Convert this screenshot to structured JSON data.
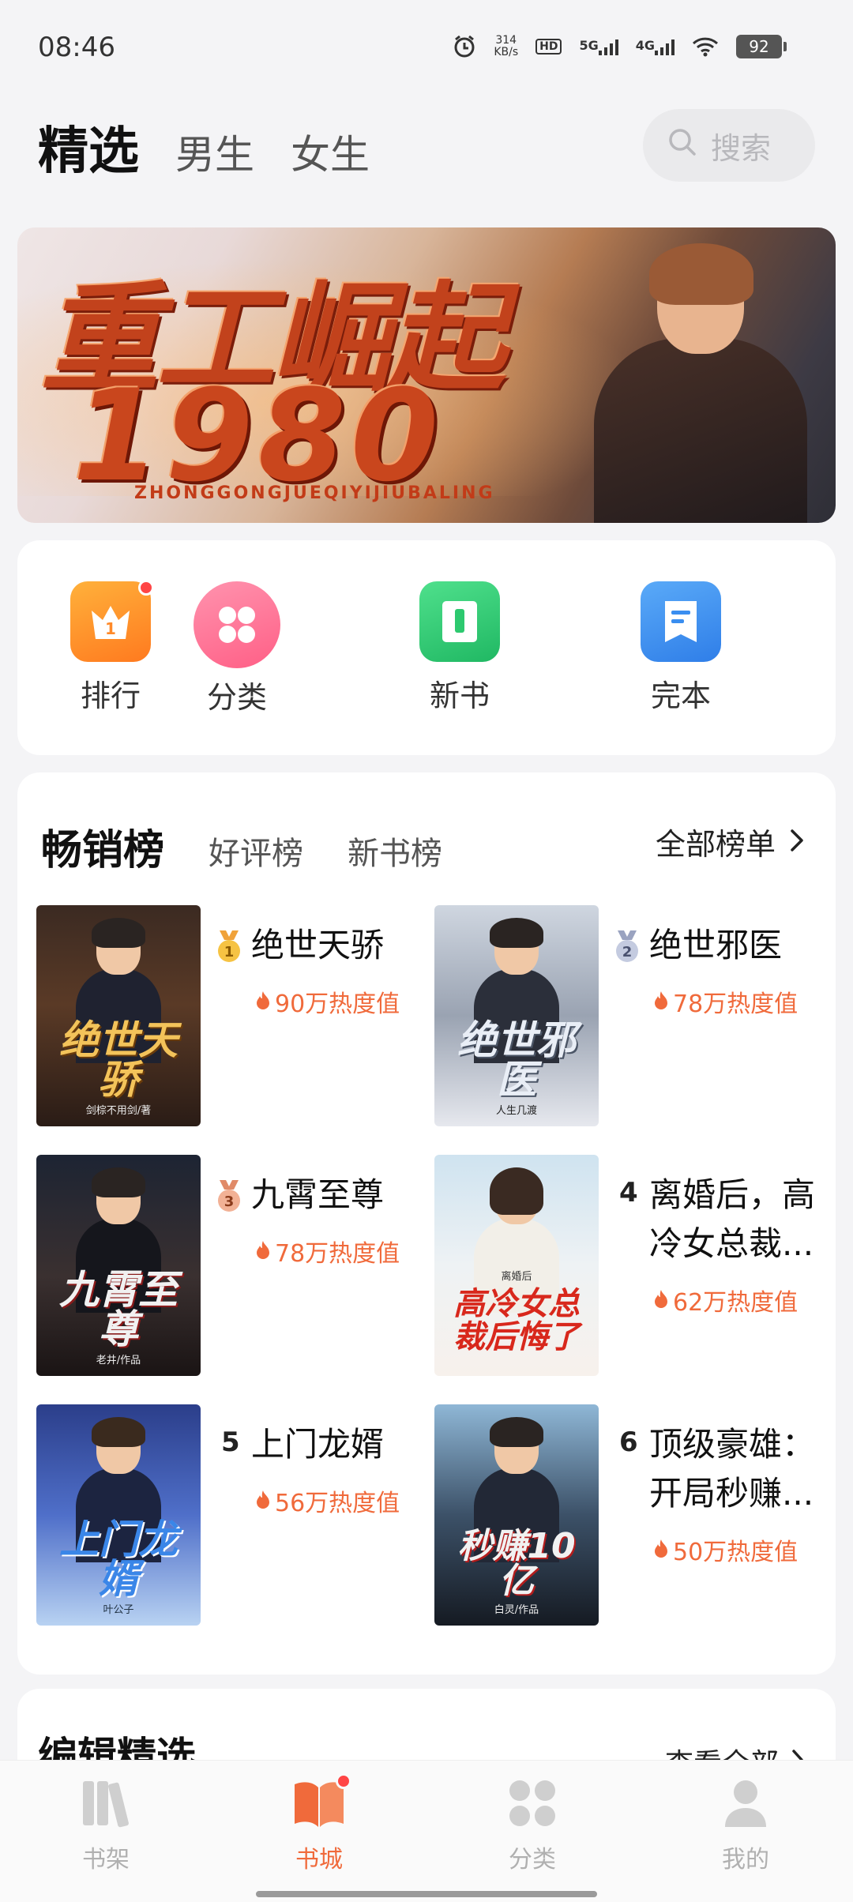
{
  "status_bar": {
    "time": "08:46",
    "net_speed_value": "314",
    "net_speed_unit": "KB/s",
    "hd_label": "HD",
    "signal_1": "5G",
    "signal_2": "4G",
    "battery": "92"
  },
  "top_tabs": [
    "精选",
    "男生",
    "女生"
  ],
  "search": {
    "placeholder": "搜索"
  },
  "banner": {
    "title": "重工崛起",
    "year": "1980",
    "subtitle": "ZHONGGONGJUEQIYIJIUBALING"
  },
  "quick_entries": [
    {
      "label": "排行",
      "icon": "crown-rank-icon",
      "color": "#ff8a2a",
      "has_dot": true
    },
    {
      "label": "分类",
      "icon": "category-grid-icon",
      "color": "#ff5f86",
      "has_dot": false
    },
    {
      "label": "新书",
      "icon": "new-book-icon",
      "color": "#2dc96f",
      "has_dot": false
    },
    {
      "label": "完本",
      "icon": "finished-book-icon",
      "color": "#3a8ef0",
      "has_dot": false
    }
  ],
  "ranking": {
    "tabs": [
      "畅销榜",
      "好评榜",
      "新书榜"
    ],
    "all_lists": "全部榜单",
    "books": [
      {
        "rank": "1",
        "title": "绝世天骄",
        "heat": "90万热度值",
        "cover_title": "绝世天骄",
        "cover_author": "剑棕不用剑/著"
      },
      {
        "rank": "2",
        "title": "绝世邪医",
        "heat": "78万热度值",
        "cover_title": "绝世邪医",
        "cover_author": "人生几渡"
      },
      {
        "rank": "3",
        "title": "九霄至尊",
        "heat": "78万热度值",
        "cover_title": "九霄至尊",
        "cover_author": "老井/作品"
      },
      {
        "rank": "4",
        "title": "离婚后，高冷女总裁...",
        "heat": "62万热度值",
        "cover_title": "高冷女总裁后悔了",
        "cover_author": "离婚后"
      },
      {
        "rank": "5",
        "title": "上门龙婿",
        "heat": "56万热度值",
        "cover_title": "上门龙婿",
        "cover_author": "叶公子"
      },
      {
        "rank": "6",
        "title": "顶级豪雄：开局秒赚...",
        "heat": "50万热度值",
        "cover_title": "秒赚10亿",
        "cover_author": "白灵/作品"
      }
    ]
  },
  "editor_pick": {
    "title": "编辑精选",
    "more": "查看全部"
  },
  "bottom_nav": [
    {
      "label": "书架",
      "icon": "bookshelf-icon",
      "active": false,
      "dot": false
    },
    {
      "label": "书城",
      "icon": "bookstore-icon",
      "active": true,
      "dot": true
    },
    {
      "label": "分类",
      "icon": "category-icon",
      "active": false,
      "dot": false
    },
    {
      "label": "我的",
      "icon": "profile-icon",
      "active": false,
      "dot": false
    }
  ],
  "colors": {
    "accent": "#f06a3b",
    "background": "#f4f4f6",
    "card": "#ffffff"
  }
}
